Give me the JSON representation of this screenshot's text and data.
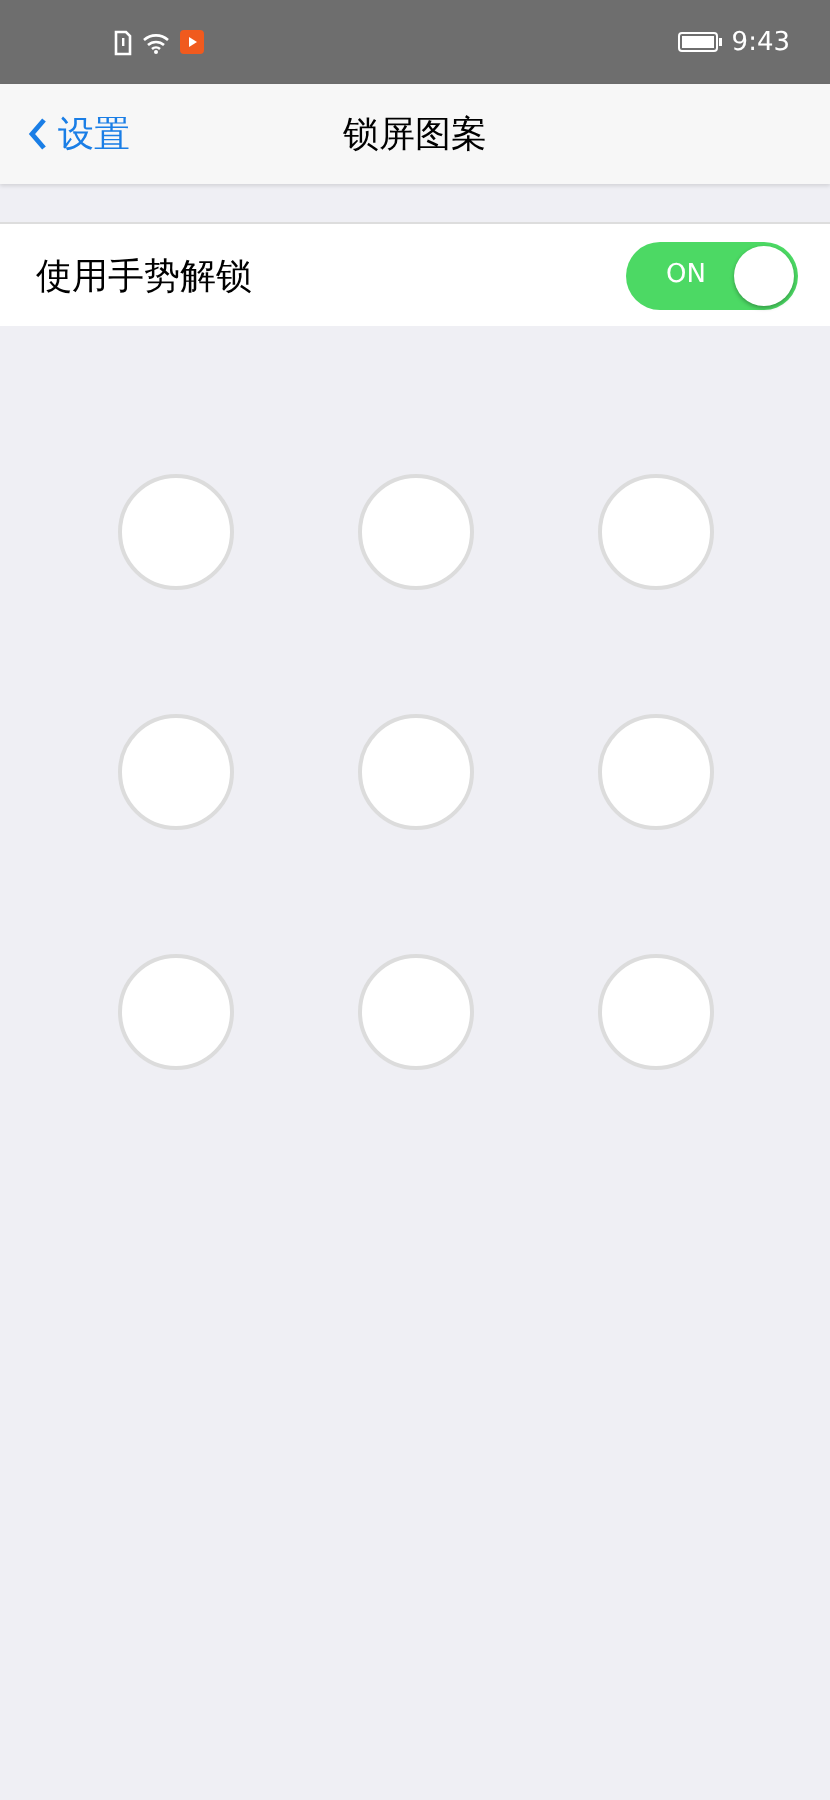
{
  "status_bar": {
    "time": "9:43"
  },
  "nav": {
    "back": "设置",
    "title": "锁屏图案"
  },
  "setting": {
    "label": "使用手势解锁",
    "on": true,
    "toggle_text": "ON"
  },
  "dots": [
    {
      "selected": false
    },
    {
      "selected": false
    },
    {
      "selected": false
    },
    {
      "selected": false
    },
    {
      "selected": false
    },
    {
      "selected": false
    },
    {
      "selected": false
    },
    {
      "selected": false
    },
    {
      "selected": false
    }
  ]
}
